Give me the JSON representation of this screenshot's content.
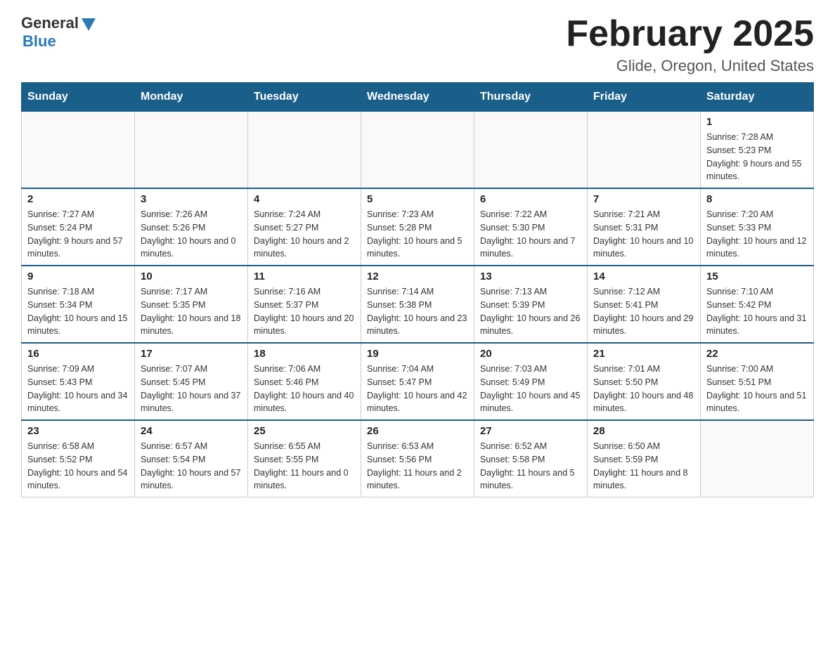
{
  "header": {
    "logo_general": "General",
    "logo_blue": "Blue",
    "title": "February 2025",
    "location": "Glide, Oregon, United States"
  },
  "weekdays": [
    "Sunday",
    "Monday",
    "Tuesday",
    "Wednesday",
    "Thursday",
    "Friday",
    "Saturday"
  ],
  "weeks": [
    [
      {
        "day": "",
        "sunrise": "",
        "sunset": "",
        "daylight": ""
      },
      {
        "day": "",
        "sunrise": "",
        "sunset": "",
        "daylight": ""
      },
      {
        "day": "",
        "sunrise": "",
        "sunset": "",
        "daylight": ""
      },
      {
        "day": "",
        "sunrise": "",
        "sunset": "",
        "daylight": ""
      },
      {
        "day": "",
        "sunrise": "",
        "sunset": "",
        "daylight": ""
      },
      {
        "day": "",
        "sunrise": "",
        "sunset": "",
        "daylight": ""
      },
      {
        "day": "1",
        "sunrise": "Sunrise: 7:28 AM",
        "sunset": "Sunset: 5:23 PM",
        "daylight": "Daylight: 9 hours and 55 minutes."
      }
    ],
    [
      {
        "day": "2",
        "sunrise": "Sunrise: 7:27 AM",
        "sunset": "Sunset: 5:24 PM",
        "daylight": "Daylight: 9 hours and 57 minutes."
      },
      {
        "day": "3",
        "sunrise": "Sunrise: 7:26 AM",
        "sunset": "Sunset: 5:26 PM",
        "daylight": "Daylight: 10 hours and 0 minutes."
      },
      {
        "day": "4",
        "sunrise": "Sunrise: 7:24 AM",
        "sunset": "Sunset: 5:27 PM",
        "daylight": "Daylight: 10 hours and 2 minutes."
      },
      {
        "day": "5",
        "sunrise": "Sunrise: 7:23 AM",
        "sunset": "Sunset: 5:28 PM",
        "daylight": "Daylight: 10 hours and 5 minutes."
      },
      {
        "day": "6",
        "sunrise": "Sunrise: 7:22 AM",
        "sunset": "Sunset: 5:30 PM",
        "daylight": "Daylight: 10 hours and 7 minutes."
      },
      {
        "day": "7",
        "sunrise": "Sunrise: 7:21 AM",
        "sunset": "Sunset: 5:31 PM",
        "daylight": "Daylight: 10 hours and 10 minutes."
      },
      {
        "day": "8",
        "sunrise": "Sunrise: 7:20 AM",
        "sunset": "Sunset: 5:33 PM",
        "daylight": "Daylight: 10 hours and 12 minutes."
      }
    ],
    [
      {
        "day": "9",
        "sunrise": "Sunrise: 7:18 AM",
        "sunset": "Sunset: 5:34 PM",
        "daylight": "Daylight: 10 hours and 15 minutes."
      },
      {
        "day": "10",
        "sunrise": "Sunrise: 7:17 AM",
        "sunset": "Sunset: 5:35 PM",
        "daylight": "Daylight: 10 hours and 18 minutes."
      },
      {
        "day": "11",
        "sunrise": "Sunrise: 7:16 AM",
        "sunset": "Sunset: 5:37 PM",
        "daylight": "Daylight: 10 hours and 20 minutes."
      },
      {
        "day": "12",
        "sunrise": "Sunrise: 7:14 AM",
        "sunset": "Sunset: 5:38 PM",
        "daylight": "Daylight: 10 hours and 23 minutes."
      },
      {
        "day": "13",
        "sunrise": "Sunrise: 7:13 AM",
        "sunset": "Sunset: 5:39 PM",
        "daylight": "Daylight: 10 hours and 26 minutes."
      },
      {
        "day": "14",
        "sunrise": "Sunrise: 7:12 AM",
        "sunset": "Sunset: 5:41 PM",
        "daylight": "Daylight: 10 hours and 29 minutes."
      },
      {
        "day": "15",
        "sunrise": "Sunrise: 7:10 AM",
        "sunset": "Sunset: 5:42 PM",
        "daylight": "Daylight: 10 hours and 31 minutes."
      }
    ],
    [
      {
        "day": "16",
        "sunrise": "Sunrise: 7:09 AM",
        "sunset": "Sunset: 5:43 PM",
        "daylight": "Daylight: 10 hours and 34 minutes."
      },
      {
        "day": "17",
        "sunrise": "Sunrise: 7:07 AM",
        "sunset": "Sunset: 5:45 PM",
        "daylight": "Daylight: 10 hours and 37 minutes."
      },
      {
        "day": "18",
        "sunrise": "Sunrise: 7:06 AM",
        "sunset": "Sunset: 5:46 PM",
        "daylight": "Daylight: 10 hours and 40 minutes."
      },
      {
        "day": "19",
        "sunrise": "Sunrise: 7:04 AM",
        "sunset": "Sunset: 5:47 PM",
        "daylight": "Daylight: 10 hours and 42 minutes."
      },
      {
        "day": "20",
        "sunrise": "Sunrise: 7:03 AM",
        "sunset": "Sunset: 5:49 PM",
        "daylight": "Daylight: 10 hours and 45 minutes."
      },
      {
        "day": "21",
        "sunrise": "Sunrise: 7:01 AM",
        "sunset": "Sunset: 5:50 PM",
        "daylight": "Daylight: 10 hours and 48 minutes."
      },
      {
        "day": "22",
        "sunrise": "Sunrise: 7:00 AM",
        "sunset": "Sunset: 5:51 PM",
        "daylight": "Daylight: 10 hours and 51 minutes."
      }
    ],
    [
      {
        "day": "23",
        "sunrise": "Sunrise: 6:58 AM",
        "sunset": "Sunset: 5:52 PM",
        "daylight": "Daylight: 10 hours and 54 minutes."
      },
      {
        "day": "24",
        "sunrise": "Sunrise: 6:57 AM",
        "sunset": "Sunset: 5:54 PM",
        "daylight": "Daylight: 10 hours and 57 minutes."
      },
      {
        "day": "25",
        "sunrise": "Sunrise: 6:55 AM",
        "sunset": "Sunset: 5:55 PM",
        "daylight": "Daylight: 11 hours and 0 minutes."
      },
      {
        "day": "26",
        "sunrise": "Sunrise: 6:53 AM",
        "sunset": "Sunset: 5:56 PM",
        "daylight": "Daylight: 11 hours and 2 minutes."
      },
      {
        "day": "27",
        "sunrise": "Sunrise: 6:52 AM",
        "sunset": "Sunset: 5:58 PM",
        "daylight": "Daylight: 11 hours and 5 minutes."
      },
      {
        "day": "28",
        "sunrise": "Sunrise: 6:50 AM",
        "sunset": "Sunset: 5:59 PM",
        "daylight": "Daylight: 11 hours and 8 minutes."
      },
      {
        "day": "",
        "sunrise": "",
        "sunset": "",
        "daylight": ""
      }
    ]
  ]
}
